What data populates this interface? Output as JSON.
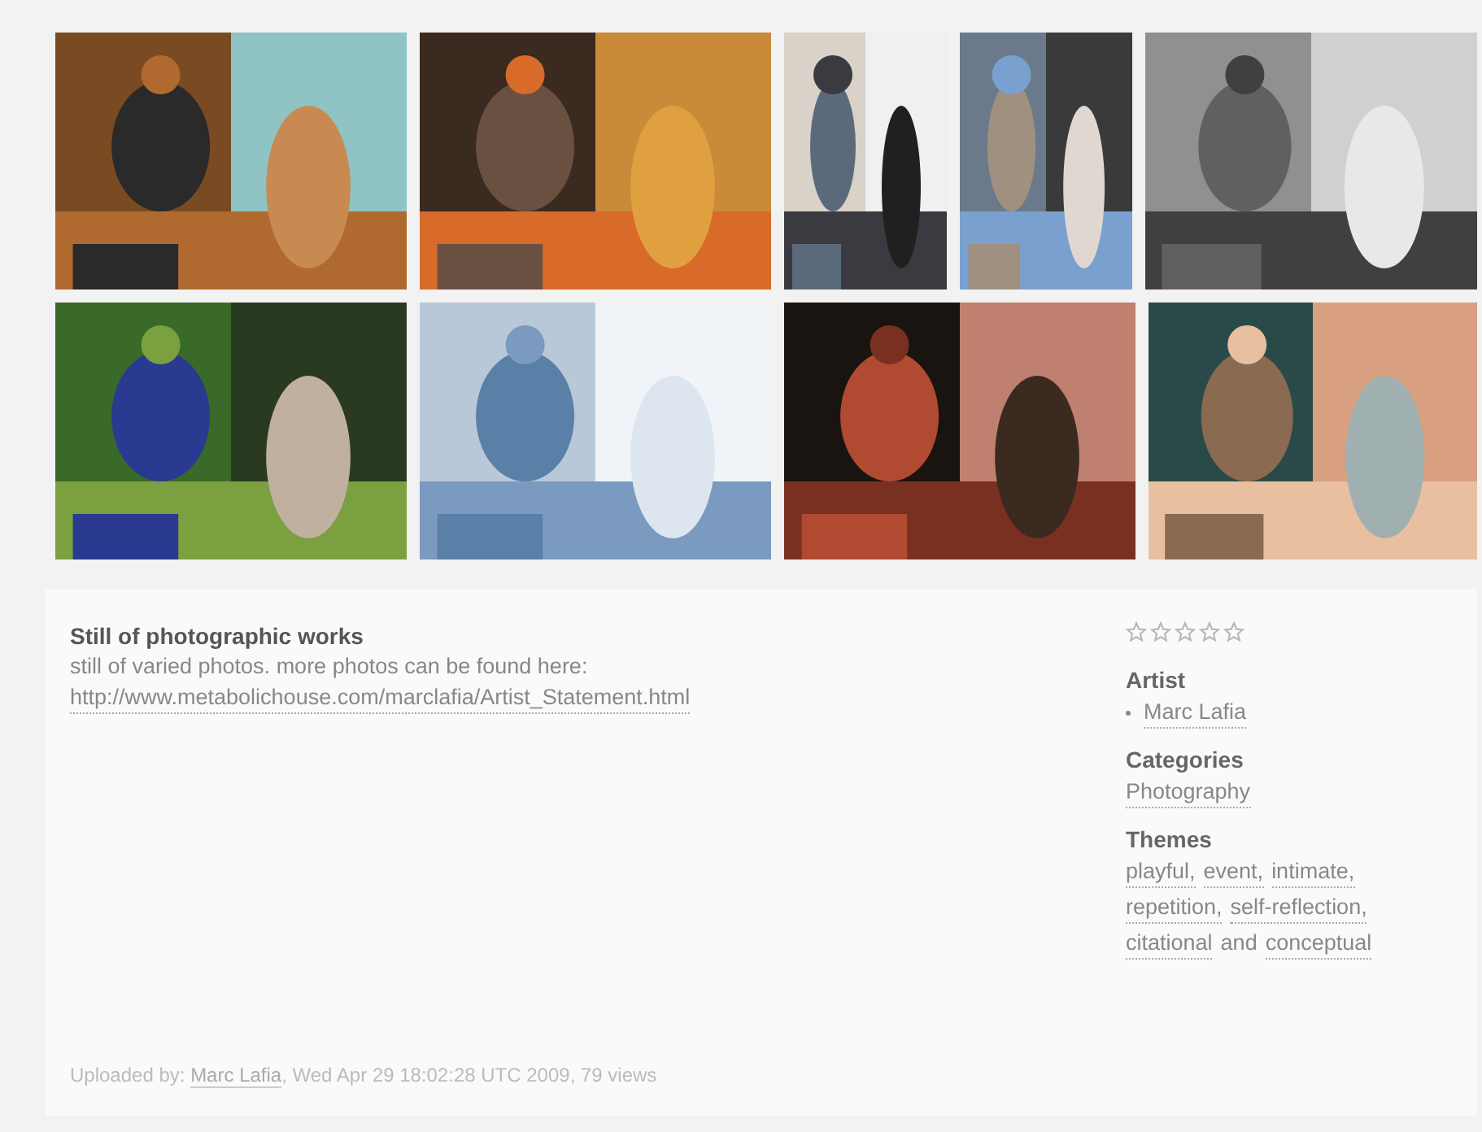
{
  "work": {
    "title": "Still of photographic works",
    "description": "still of varied photos. more photos can be found here:",
    "link": "http://www.metabolichouse.com/marclafia/Artist_Statement.html"
  },
  "rating": {
    "stars": 0
  },
  "artist": {
    "heading": "Artist",
    "names": [
      "Marc Lafia"
    ]
  },
  "categories": {
    "heading": "Categories",
    "items": [
      "Photography"
    ]
  },
  "themes": {
    "heading": "Themes",
    "items": [
      {
        "kind": "link",
        "text": "playful,"
      },
      {
        "kind": "link",
        "text": "event,"
      },
      {
        "kind": "link",
        "text": "intimate,"
      },
      {
        "kind": "link",
        "text": "repetition,"
      },
      {
        "kind": "link",
        "text": "self-reflection,"
      },
      {
        "kind": "link",
        "text": "citational"
      },
      {
        "kind": "text",
        "text": "and"
      },
      {
        "kind": "link",
        "text": "conceptual"
      }
    ]
  },
  "footer": {
    "label": "Uploaded by:",
    "uploader": "Marc Lafia",
    "details": ", Wed Apr 29 18:02:28 UTC 2009, 79 views"
  }
}
